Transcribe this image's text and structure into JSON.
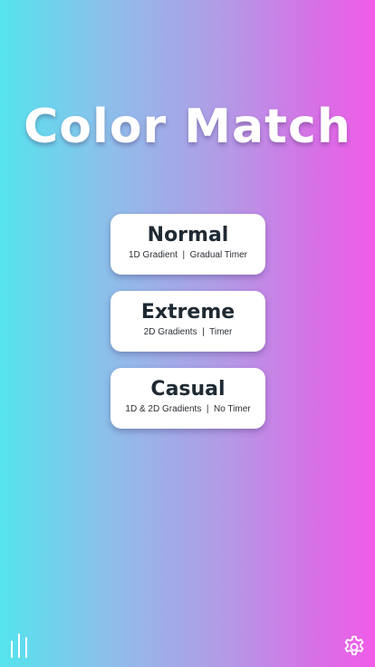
{
  "app": {
    "title": "Color Match"
  },
  "modes": [
    {
      "name": "Normal",
      "description": "1D Gradient  |  Gradual Timer"
    },
    {
      "name": "Extreme",
      "description": "2D Gradients  |  Timer"
    },
    {
      "name": "Casual",
      "description": "1D & 2D Gradients  |  No Timer"
    }
  ],
  "icons": {
    "bottom_left": "stats-icon",
    "bottom_right": "gear-icon"
  },
  "colors": {
    "gradient_left": "#55e4ee",
    "gradient_right": "#f15ce8",
    "card_background": "#ffffff",
    "card_text": "#1f2a33"
  }
}
